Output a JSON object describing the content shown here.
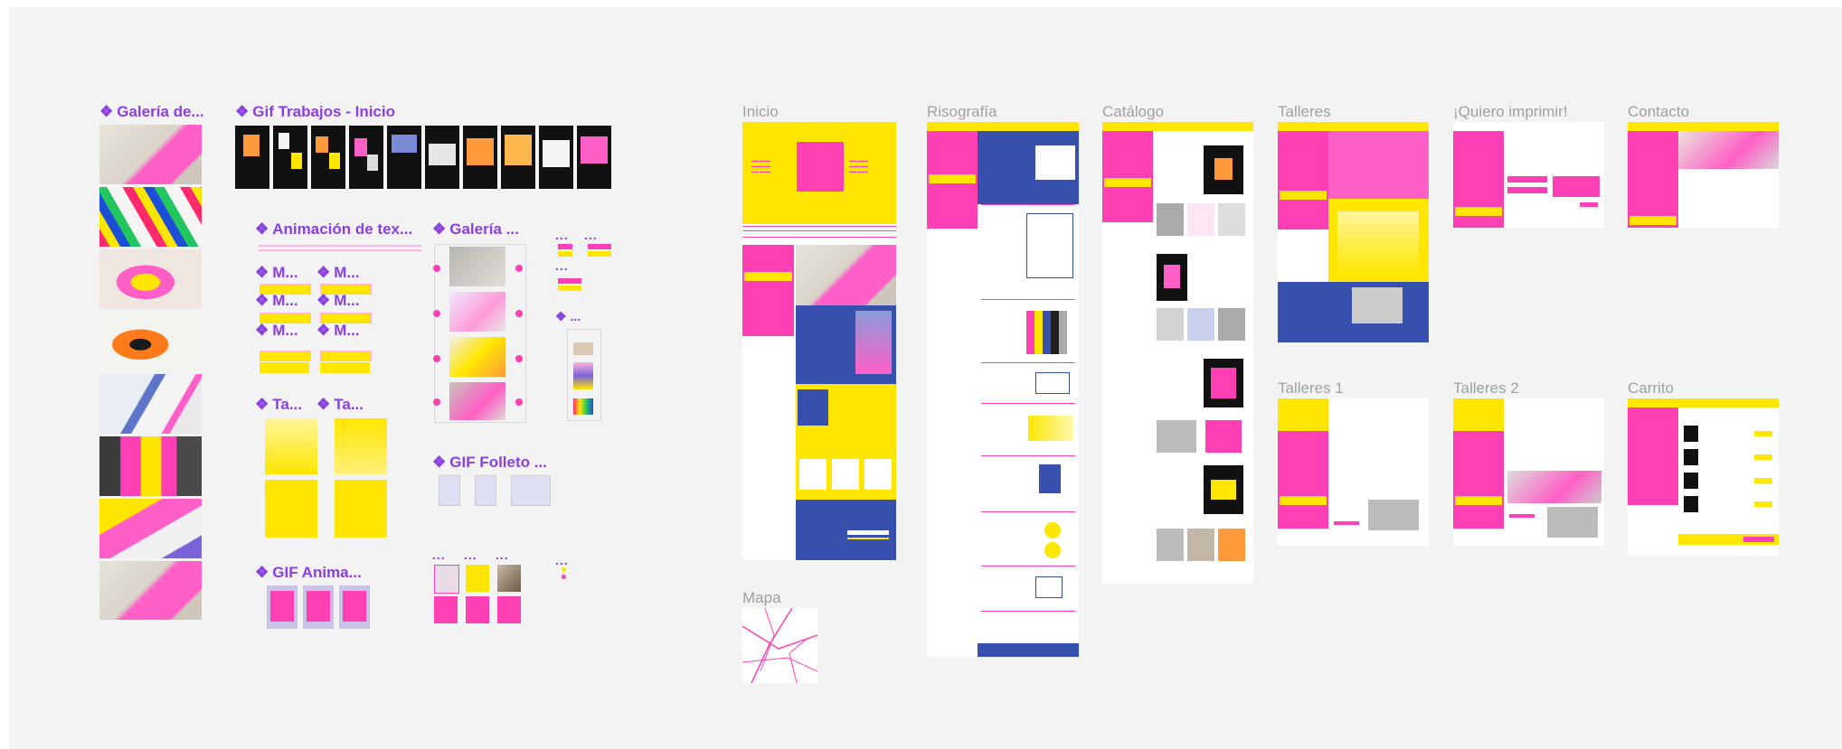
{
  "components": {
    "galeria_de": "Galería de...",
    "gif_trabajos": "Gif Trabajos - Inicio",
    "animacion_tex": "Animación de tex...",
    "galeria_short": "Galería ...",
    "m1": "M...",
    "m2": "M...",
    "m3": "M...",
    "m4": "M...",
    "m5": "M...",
    "m6": "M...",
    "ta1": "Ta...",
    "ta2": "Ta...",
    "gif_folleto": "GIF Folleto ...",
    "gif_anima": "GIF Anima...",
    "diamond": "❖",
    "ellipsis": "..."
  },
  "menu_buttons": [
    "Risografía",
    "Catálogo",
    "Talleres",
    "Contacto"
  ],
  "frames": {
    "inicio": "Inicio",
    "risografia": "Risografía",
    "catalogo": "Catálogo",
    "talleres": "Talleres",
    "quiero_imprimir": "¡Quiero imprimir!",
    "contacto": "Contacto",
    "mapa": "Mapa",
    "talleres1": "Talleres 1",
    "talleres2": "Talleres 2",
    "carrito": "Carrito"
  },
  "colors": {
    "pink": "#ff3fb4",
    "yellow": "#ffe600",
    "blue": "#3750ad",
    "purple": "#8a3fe0",
    "canvas": "#f3f3f3"
  }
}
